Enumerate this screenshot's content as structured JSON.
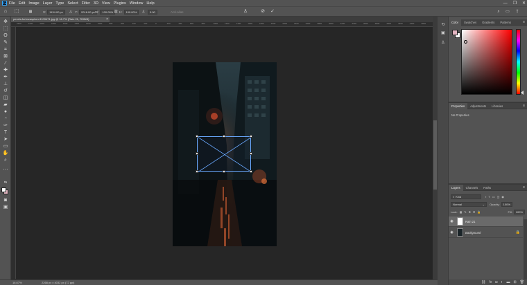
{
  "app": {
    "logo": "Ps",
    "menu": [
      "File",
      "Edit",
      "Image",
      "Layer",
      "Type",
      "Select",
      "Filter",
      "3D",
      "View",
      "Plugins",
      "Window",
      "Help"
    ],
    "window_controls": [
      "—",
      "❐",
      "✕"
    ]
  },
  "options": {
    "x_label": "X:",
    "x_value": "1134.00 px",
    "y_label": "Y:",
    "y_value": "2016.00 px",
    "w_label": "W:",
    "w_value": "100.00%",
    "h_label": "H:",
    "h_value": "100.00%",
    "angle_value": "0.00",
    "interp_label": "Anti-alias"
  },
  "document": {
    "tab_title": "pexels-forknvasplom-3109471.jpg @ 16.7% (Rain 21, RGB/8)",
    "tab_close": "×"
  },
  "ruler": {
    "ticks": [
      "2400",
      "2200",
      "2000",
      "1800",
      "1600",
      "1400",
      "1200",
      "1000",
      "800",
      "600",
      "400",
      "200",
      "0",
      "200",
      "400",
      "600",
      "800",
      "1000",
      "1200",
      "1400",
      "1600",
      "1800",
      "2000",
      "2200",
      "2400",
      "2600",
      "2800",
      "3000",
      "3200",
      "3400",
      "3600",
      "3800",
      "4000",
      "4200",
      "4400",
      "4600"
    ]
  },
  "status": {
    "zoom": "16.67%",
    "info": "2268 px x 4032 px (72 ppi)"
  },
  "panels": {
    "color_tabs": [
      "Color",
      "Swatches",
      "Gradients",
      "Patterns"
    ],
    "properties_tabs": [
      "Properties",
      "Adjustments",
      "Libraries"
    ],
    "properties_text": "No Properties",
    "layers_tabs": [
      "Layers",
      "Channels",
      "Paths"
    ],
    "kind": "Kind",
    "blend_mode": "Normal",
    "opacity_label": "Opacity:",
    "opacity_value": "100%",
    "lock_label": "Lock:",
    "fill_label": "Fill:",
    "fill_value": "100%",
    "layers": [
      {
        "name": "Rain 21",
        "selected": true
      },
      {
        "name": "Background",
        "selected": false
      }
    ]
  },
  "colors": {
    "accent": "#31a8ff",
    "foreground": "#e2b4c0",
    "background": "#ffffff"
  }
}
